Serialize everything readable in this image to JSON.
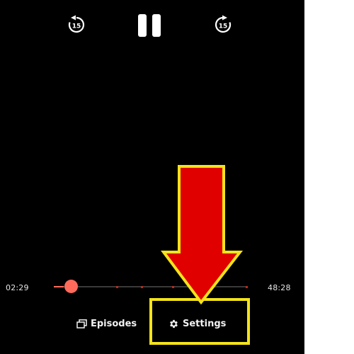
{
  "player": {
    "rewind_icon": "rewind-15-icon",
    "rewind_seconds": "15",
    "pause_icon": "pause-icon",
    "forward_icon": "forward-15-icon",
    "forward_seconds": "15",
    "time_elapsed": "02:29",
    "time_total": "48:28",
    "progress_fraction": 0.05,
    "chapter_marks": [
      0.32,
      0.45,
      0.61,
      0.79,
      0.99
    ],
    "episodes_label": "Episodes",
    "episodes_icon": "episodes-stack-icon",
    "settings_label": "Settings",
    "settings_icon": "gear-icon"
  },
  "annotation": {
    "arrow_color": "#e00000",
    "outline_color": "#f4e31a",
    "target": "settings-button"
  },
  "colors": {
    "background": "#000000",
    "progress": "#ff6b5b",
    "chapter_mark": "#c0281c"
  }
}
